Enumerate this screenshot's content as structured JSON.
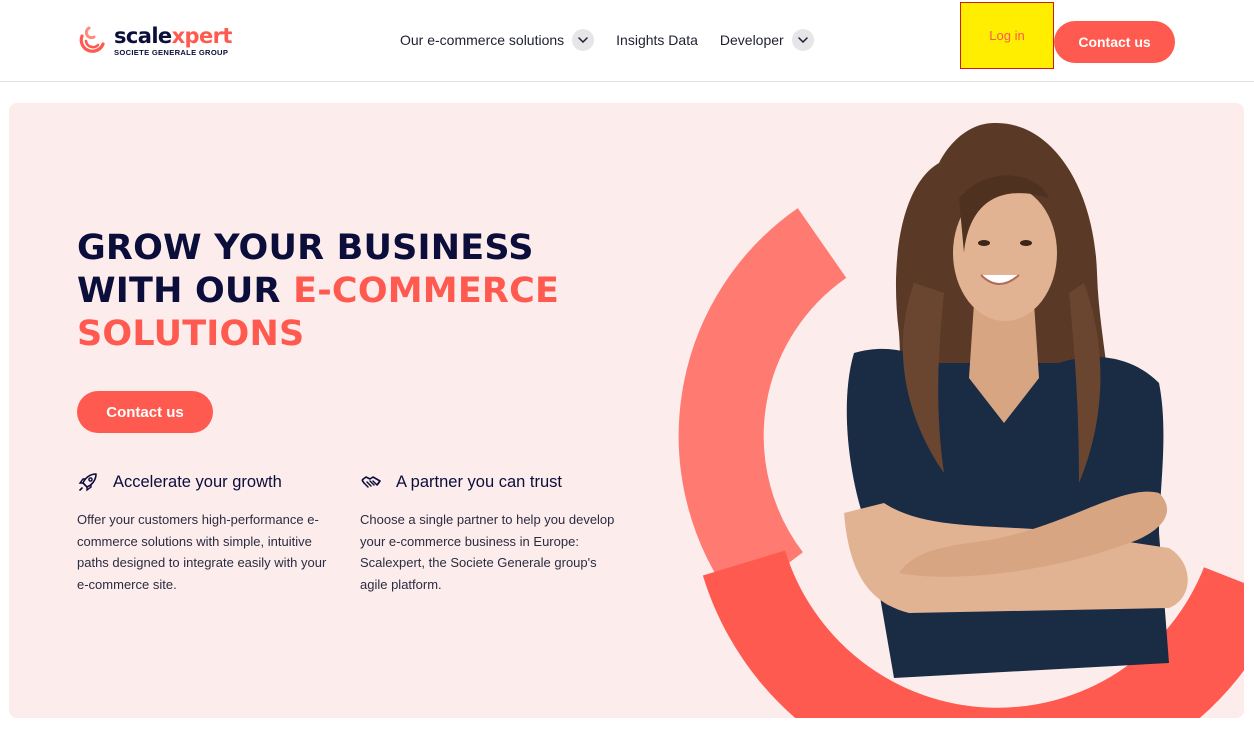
{
  "header": {
    "logo": {
      "word_main": "scale",
      "word_accent": "xpert",
      "subtitle": "SOCIETE GENERALE GROUP"
    },
    "nav": [
      {
        "label": "Our e-commerce solutions",
        "has_dropdown": true
      },
      {
        "label": "Insights Data",
        "has_dropdown": false
      },
      {
        "label": "Developer",
        "has_dropdown": true
      }
    ],
    "login_label": "Log in",
    "contact_label": "Contact us"
  },
  "hero": {
    "headline_line1": "GROW YOUR BUSINESS",
    "headline_line2_dark": "WITH OUR ",
    "headline_line2_accent": "E-COMMERCE",
    "headline_line3_accent": "SOLUTIONS",
    "cta_label": "Contact us",
    "features": [
      {
        "icon": "rocket-icon",
        "title": "Accelerate your growth",
        "body": "Offer your customers high-performance e-commerce solutions with simple, intuitive paths designed to integrate easily with your e-commerce site."
      },
      {
        "icon": "handshake-icon",
        "title": "A partner you can trust",
        "body": "Choose a single partner to help you develop your e-commerce business in Europe: Scalexpert, the Societe Generale group's agile platform."
      }
    ]
  },
  "colors": {
    "accent": "#ff5a4f",
    "navy": "#0b0d3a",
    "hero_bg": "#fdecec",
    "login_highlight": "#ffee00"
  }
}
